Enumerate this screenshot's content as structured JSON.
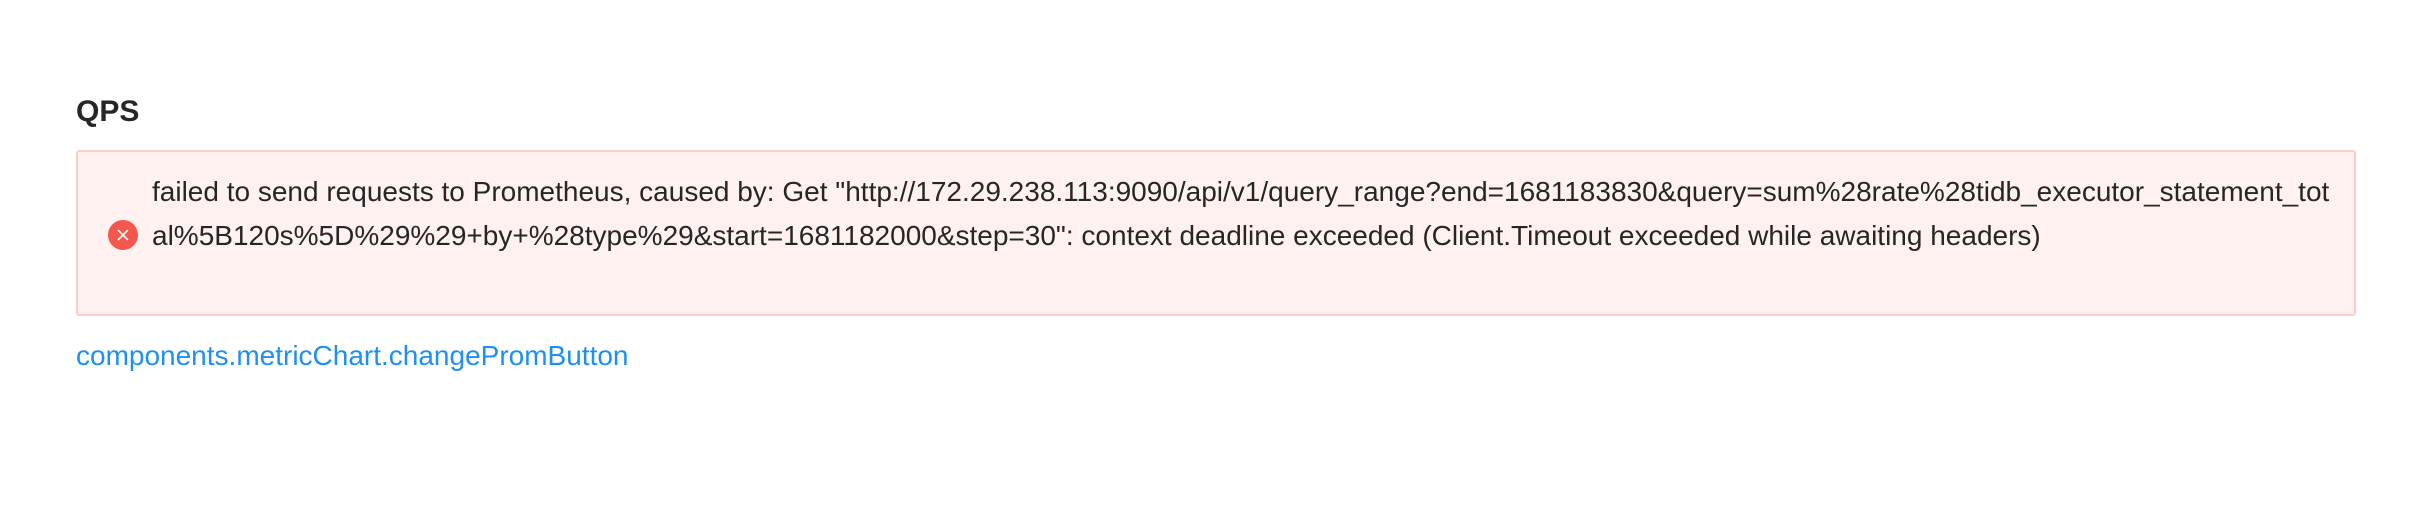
{
  "panel": {
    "title": "QPS"
  },
  "alert": {
    "type": "error",
    "icon": "close-circle-icon",
    "color": "#f5574f",
    "message": "failed to send requests to Prometheus, caused by: Get \"http://172.29.238.113:9090/api/v1/query_range?end=1681183830&query=sum%28rate%28tidb_executor_statement_total%5B120s%5D%29%29+by+%28type%29&start=1681182000&step=30\": context deadline exceeded (Client.Timeout exceeded while awaiting headers)"
  },
  "link": {
    "label": "components.metricChart.changePromButton",
    "color": "#1f8ff2"
  }
}
